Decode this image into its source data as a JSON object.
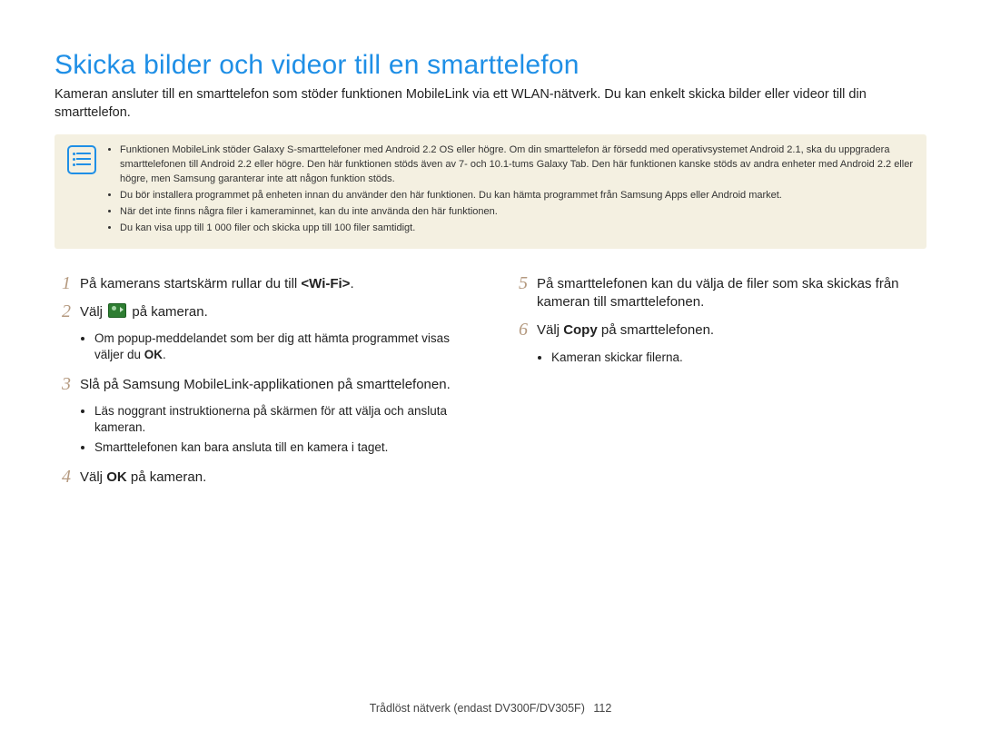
{
  "title": "Skicka bilder och videor till en smarttelefon",
  "intro": "Kameran ansluter till en smarttelefon som stöder funktionen MobileLink via ett WLAN-nätverk. Du kan enkelt skicka bilder eller videor till din smarttelefon.",
  "note_icon_name": "note-list-icon",
  "notes": [
    "Funktionen MobileLink stöder Galaxy S-smarttelefoner med Android 2.2 OS eller högre. Om din smarttelefon är försedd med operativsystemet Android 2.1, ska du uppgradera smarttelefonen till Android 2.2 eller högre. Den här funktionen stöds även av 7- och 10.1-tums Galaxy Tab. Den här funktionen kanske stöds av andra enheter med Android 2.2 eller högre, men Samsung garanterar inte att någon funktion stöds.",
    "Du bör installera programmet på enheten innan du använder den här funktionen. Du kan hämta programmet från Samsung Apps eller Android market.",
    "När det inte finns några filer i kameraminnet, kan du inte använda den här funktionen.",
    "Du kan visa upp till 1 000 filer och skicka upp till 100 filer samtidigt."
  ],
  "left_steps": {
    "s1": {
      "num": "1",
      "pre": "På kamerans startskärm rullar du till ",
      "bold": "<Wi-Fi>",
      "post": "."
    },
    "s2": {
      "num": "2",
      "pre": "Välj ",
      "icon": "mobilelink-icon",
      "post": " på kameran.",
      "bullets": [
        {
          "pre": "Om popup-meddelandet som ber dig att hämta programmet visas väljer du ",
          "bold": "OK",
          "post": "."
        }
      ]
    },
    "s3": {
      "num": "3",
      "text": "Slå på Samsung MobileLink-applikationen på smarttelefonen.",
      "bullets_plain": [
        "Läs noggrant instruktionerna på skärmen för att välja och ansluta kameran.",
        "Smarttelefonen kan bara ansluta till en kamera i taget."
      ]
    },
    "s4": {
      "num": "4",
      "pre": "Välj ",
      "bold": "OK",
      "post": " på kameran."
    }
  },
  "right_steps": {
    "s5": {
      "num": "5",
      "text": "På smarttelefonen kan du välja de filer som ska skickas från kameran till smarttelefonen."
    },
    "s6": {
      "num": "6",
      "pre": "Välj ",
      "bold": "Copy",
      "post": " på smarttelefonen.",
      "bullets_plain": [
        "Kameran skickar filerna."
      ]
    }
  },
  "footer": {
    "section": "Trådlöst nätverk (endast DV300F/DV305F)",
    "page": "112"
  }
}
